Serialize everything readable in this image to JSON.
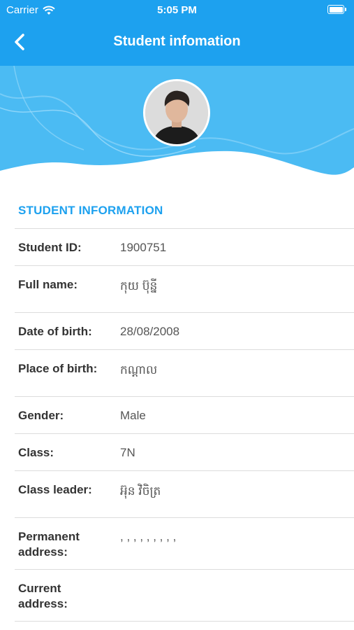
{
  "status_bar": {
    "carrier": "Carrier",
    "time": "5:05 PM"
  },
  "nav": {
    "title": "Student infomation",
    "back_icon": "chevron-left-icon"
  },
  "section": {
    "title": "STUDENT INFORMATION"
  },
  "fields": [
    {
      "label": "Student ID:",
      "value": "1900751"
    },
    {
      "label": "Full name:",
      "value": "កុយ ប៊ុន្នី"
    },
    {
      "label": "Date of birth:",
      "value": "28/08/2008"
    },
    {
      "label": "Place of birth:",
      "value": "កណ្ដាល"
    },
    {
      "label": "Gender:",
      "value": "Male"
    },
    {
      "label": "Class:",
      "value": "7N"
    },
    {
      "label": "Class leader:",
      "value": "អ៊ុន វិចិត្រ"
    },
    {
      "label": "Permanent address:",
      "value": ", , , , , , , , ,"
    },
    {
      "label": "Current address:",
      "value": ""
    }
  ],
  "colors": {
    "primary": "#1da1ef",
    "hero": "#4bbbf3"
  }
}
